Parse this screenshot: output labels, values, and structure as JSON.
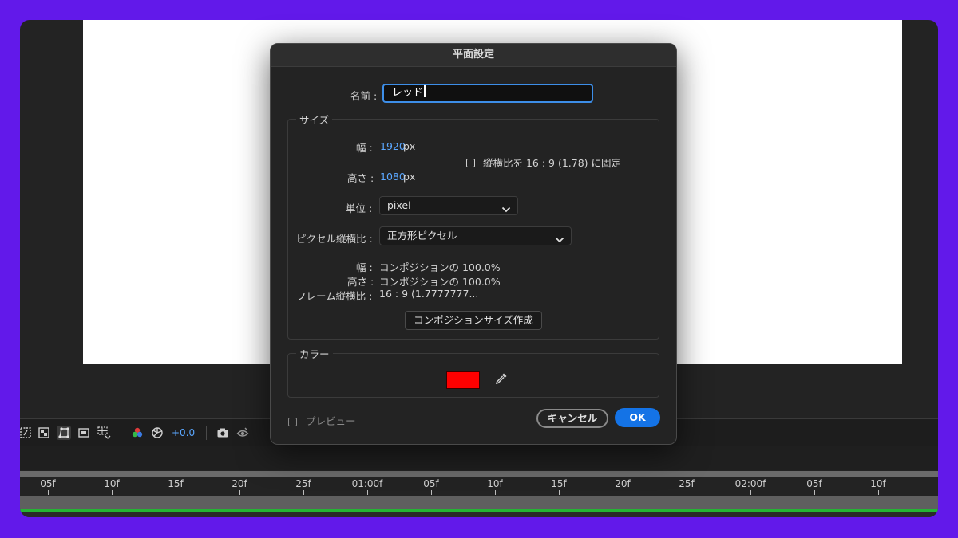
{
  "dialog": {
    "title": "平面設定",
    "name_label": "名前 :",
    "name_value": "レッド",
    "size_group": "サイズ",
    "width_label": "幅 :",
    "width_value": "1920",
    "height_label": "高さ :",
    "height_value": "1080",
    "unit_px": "px",
    "lock_aspect_label": "縦横比を 16 : 9 (1.78) に固定",
    "unit_label": "単位 :",
    "unit_value": "pixel",
    "pixel_aspect_label": "ピクセル縦横比 :",
    "pixel_aspect_value": "正方形ピクセル",
    "info_width_label": "幅 :",
    "info_width_value": "コンポジションの 100.0%",
    "info_height_label": "高さ :",
    "info_height_value": "コンポジションの 100.0%",
    "info_frame_label": "フレーム縦横比 :",
    "info_frame_value": "16 : 9 (1.7777777...",
    "comp_size_button": "コンポジションサイズ作成",
    "color_group": "カラー",
    "color_value": "#ff0000",
    "preview_label": "プレビュー",
    "cancel_button": "キャンセル",
    "ok_button": "OK"
  },
  "viewer_toolbar": {
    "exposure_value": "+0.0"
  },
  "timeline": {
    "ticks": [
      "05f",
      "10f",
      "15f",
      "20f",
      "25f",
      "01:00f",
      "05f",
      "10f",
      "15f",
      "20f",
      "25f",
      "02:00f",
      "05f",
      "10f"
    ]
  },
  "colors": {
    "accent": "#1473e6",
    "value_blue": "#5aa7ff",
    "frame": "#6219ea",
    "timeline_green": "#25b434"
  }
}
